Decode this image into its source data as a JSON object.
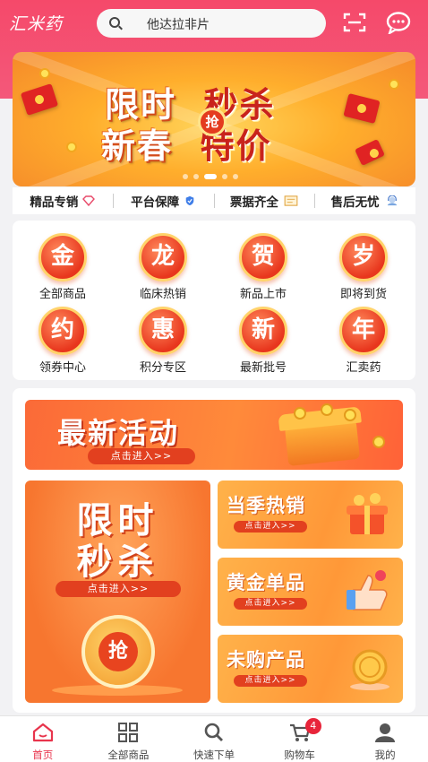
{
  "header": {
    "logo_text": "汇米药",
    "search_placeholder": "他达拉非片",
    "scan_icon": "scan-icon",
    "message_icon": "message-icon"
  },
  "banner": {
    "line1_left": "限时",
    "line1_right": "秒杀",
    "line2_left": "新春",
    "line2_right": "特价",
    "badge": "抢",
    "carousel_count": 5,
    "carousel_active": 2
  },
  "features": [
    {
      "label": "精品专销",
      "icon": "diamond-icon"
    },
    {
      "label": "平台保障",
      "icon": "shield-icon"
    },
    {
      "label": "票据齐全",
      "icon": "invoice-icon"
    },
    {
      "label": "售后无忧",
      "icon": "support-icon"
    }
  ],
  "categories": [
    {
      "glyph": "金",
      "label": "全部商品"
    },
    {
      "glyph": "龙",
      "label": "临床热销"
    },
    {
      "glyph": "贺",
      "label": "新品上市"
    },
    {
      "glyph": "岁",
      "label": "即将到货"
    },
    {
      "glyph": "约",
      "label": "领券中心"
    },
    {
      "glyph": "惠",
      "label": "积分专区"
    },
    {
      "glyph": "新",
      "label": "最新批号"
    },
    {
      "glyph": "年",
      "label": "汇卖药"
    }
  ],
  "promos": {
    "latest": {
      "title": "最新活动",
      "cta": "点击进入>>"
    },
    "flash": {
      "line1": "限时",
      "line2": "秒杀",
      "cta": "点击进入>>",
      "badge": "抢"
    },
    "side": [
      {
        "title": "当季热销",
        "cta": "点击进入>>"
      },
      {
        "title": "黄金单品",
        "cta": "点击进入>>"
      },
      {
        "title": "未购产品",
        "cta": "点击进入>>"
      }
    ]
  },
  "nav": [
    {
      "label": "首页",
      "icon": "home-icon",
      "active": true
    },
    {
      "label": "全部商品",
      "icon": "grid-icon",
      "active": false
    },
    {
      "label": "快速下单",
      "icon": "search-icon",
      "active": false
    },
    {
      "label": "购物车",
      "icon": "cart-icon",
      "active": false,
      "badge": "4"
    },
    {
      "label": "我的",
      "icon": "user-icon",
      "active": false
    }
  ],
  "colors": {
    "brand": "#f5496a",
    "accent": "#e8344c",
    "promo": "#f7762f"
  }
}
